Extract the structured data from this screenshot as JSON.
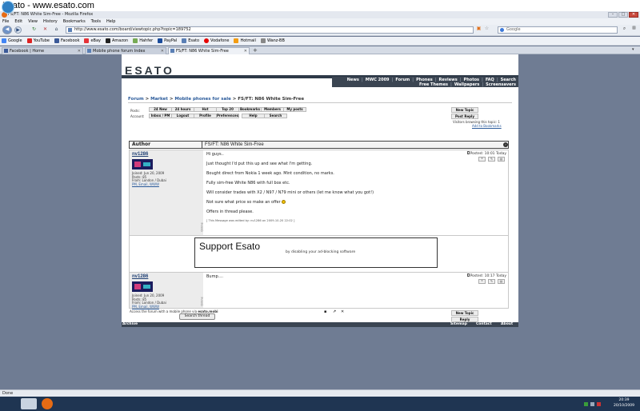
{
  "caption": "Esato - www.esato.com",
  "browser": {
    "window_title": "FS/FT: N86 White Sim-Free - Mozilla Firefox",
    "menus": [
      "File",
      "Edit",
      "View",
      "History",
      "Bookmarks",
      "Tools",
      "Help"
    ],
    "url": "http://www.esato.com/board/viewtopic.php?topic=189752",
    "search_placeholder": "Google",
    "bookmarks": [
      "Google",
      "YouTube",
      "Facebook",
      "eBay",
      "Amazon",
      "Hahfer",
      "PayPal",
      "Esato",
      "Vodafone",
      "Hotmail",
      "Wanz-BB"
    ],
    "tabs": [
      {
        "label": "Facebook | Home"
      },
      {
        "label": "Mobile phone forum Index"
      },
      {
        "label": "FS/FT: N86 White Sim-Free",
        "active": true
      }
    ],
    "status": "Done"
  },
  "site": {
    "logo": "ESATO",
    "nav_row1": [
      "News",
      "MWC 2009",
      "Forum",
      "Phones",
      "Reviews",
      "Photos",
      "FAQ",
      "Search"
    ],
    "nav_row2": [
      "Free Themes",
      "Wallpapers",
      "Screensavers"
    ],
    "breadcrumb": {
      "forum": "Forum",
      "market": "Market",
      "category": "Mobile phones for sale",
      "topic": "FS/FT: N86 White Sim-Free",
      "sep": ">"
    },
    "posts_label": "Posts:",
    "account_label": "Account:",
    "posts_buttons": [
      "24 New",
      "24 hours",
      "Hot",
      "Top 20",
      "Bookmarks",
      "Members",
      "My posts"
    ],
    "account_buttons": [
      "Inbox / PM",
      "Logout",
      "Profile",
      "Preferences",
      "Help",
      "Search"
    ],
    "new_topic": "New Topic",
    "post_reply": "Post Reply",
    "browsing": "Visitors browsing this topic: 1",
    "add_bookmark": "Add to Bookmarks"
  },
  "thread": {
    "header_author": "Author",
    "header_title": "FS/FT: N86 White Sim-Free",
    "posts": [
      {
        "author": "nv1286",
        "joined": "Joined: Jun 20, 2009",
        "posts": "Posts: 85",
        "from": "From: London / Dubai",
        "links": "PM, Email, WWW",
        "online": "Online",
        "posted": "Posted: 10:01 Today",
        "lines": [
          "Hi guys..",
          "Just thought I'd put this up and see what I'm getting.",
          "Bought direct from Nokia 1 week ago. Mint condition, no marks.",
          "Fully sim-free White N86 with full box etc.",
          "Will consider trades with X2 / N97 / N79 mini or others (let me know what you got!)",
          "Not sure what price so make an offer",
          "Offers in thread please."
        ],
        "edited": "[ This Message was edited by: nv1286 on 2009-10-20 22:02 ]"
      },
      {
        "author": "nv1286",
        "joined": "Joined: Jun 20, 2009",
        "posts": "Posts: 85",
        "from": "From: London / Dubai",
        "links": "PM, Email, WWW",
        "online": "Online",
        "posted": "Posted: 10:17 Today",
        "lines": [
          "Bump...."
        ]
      }
    ]
  },
  "ad": {
    "title": "Support Esato",
    "subtitle": "by disabling your ad-blocking software"
  },
  "footer": {
    "note_prefix": "Access the forum with a mobile phone via",
    "note_link": "esato.mobi",
    "search_thread": "Search thread",
    "new_topic": "New Topic",
    "reply": "Reply",
    "archive": "Archive",
    "links": [
      "Sitemap",
      "Contact",
      "About"
    ]
  },
  "taskbar": {
    "time": "20:39",
    "date": "20/10/2009"
  }
}
